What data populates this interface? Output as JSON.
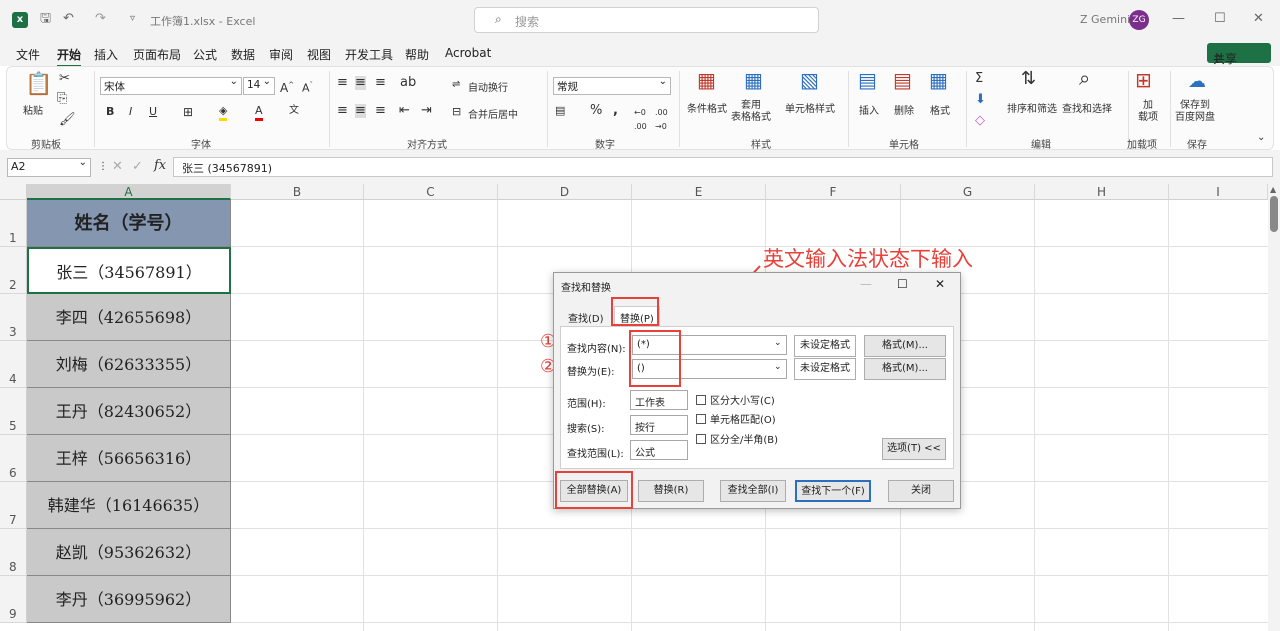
{
  "titlebar": {
    "filename": "工作簿1.xlsx  -  Excel",
    "search_placeholder": "搜索",
    "user_name": "Z Gemini",
    "user_initials": "ZG"
  },
  "menu": {
    "items": [
      "文件",
      "开始",
      "插入",
      "页面布局",
      "公式",
      "数据",
      "审阅",
      "视图",
      "开发工具",
      "帮助",
      "Acrobat"
    ],
    "active": "开始",
    "share": "共享"
  },
  "ribbon": {
    "paste": "粘贴",
    "clipboard_group": "剪贴板",
    "font_name": "宋体",
    "font_size": "14",
    "font_group": "字体",
    "wrap_text": "自动换行",
    "merge_center": "合并后居中",
    "align_group": "对齐方式",
    "number_format": "常规",
    "number_group": "数字",
    "cond_format": "条件格式",
    "table_format": "套用\n表格格式",
    "cell_style": "单元格样式",
    "styles_group": "样式",
    "insert": "插入",
    "delete": "删除",
    "format": "格式",
    "cells_group": "单元格",
    "sort_filter": "排序和筛选",
    "find_select": "查找和选择",
    "edit_group": "编辑",
    "addins": "加\n载项",
    "addins_group": "加载项",
    "save_baidu": "保存到\n百度网盘",
    "save_group": "保存"
  },
  "formula_bar": {
    "name_box": "A2",
    "content": "张三 (34567891)"
  },
  "columns": [
    "A",
    "B",
    "C",
    "D",
    "E",
    "F",
    "G",
    "H",
    "I"
  ],
  "rows": [
    "1",
    "2",
    "3",
    "4",
    "5",
    "6",
    "7",
    "8",
    "9"
  ],
  "cells": [
    "姓名（学号）",
    "张三（34567891）",
    "李四（42655698）",
    "刘梅（62633355）",
    "王丹（82430652）",
    "王梓（56656316）",
    "韩建华（16146635）",
    "赵凯（95362632）",
    "李丹（36995962）"
  ],
  "annotation": {
    "text": "英文输入法状态下输入",
    "marker1": "①",
    "marker2": "②"
  },
  "dialog": {
    "title": "查找和替换",
    "tab_find": "查找(D)",
    "tab_replace": "替换(P)",
    "find_label": "查找内容(N):",
    "find_value": "(*)",
    "replace_label": "替换为(E):",
    "replace_value": "()",
    "no_format": "未设定格式",
    "format_btn": "格式(M)...",
    "scope_label": "范围(H):",
    "scope_value": "工作表",
    "search_label": "搜索(S):",
    "search_value": "按行",
    "lookin_label": "查找范围(L):",
    "lookin_value": "公式",
    "match_case": "区分大小写(C)",
    "match_cell": "单元格匹配(O)",
    "match_width": "区分全/半角(B)",
    "options_btn": "选项(T) <<",
    "replace_all": "全部替换(A)",
    "replace": "替换(R)",
    "find_all": "查找全部(I)",
    "find_next": "查找下一个(F)",
    "close": "关闭"
  },
  "colors": {
    "header_cell": "#8496b0",
    "data_cell": "#c9c9c9",
    "excel_green": "#1e7145",
    "annotation_red": "#e8413a"
  }
}
